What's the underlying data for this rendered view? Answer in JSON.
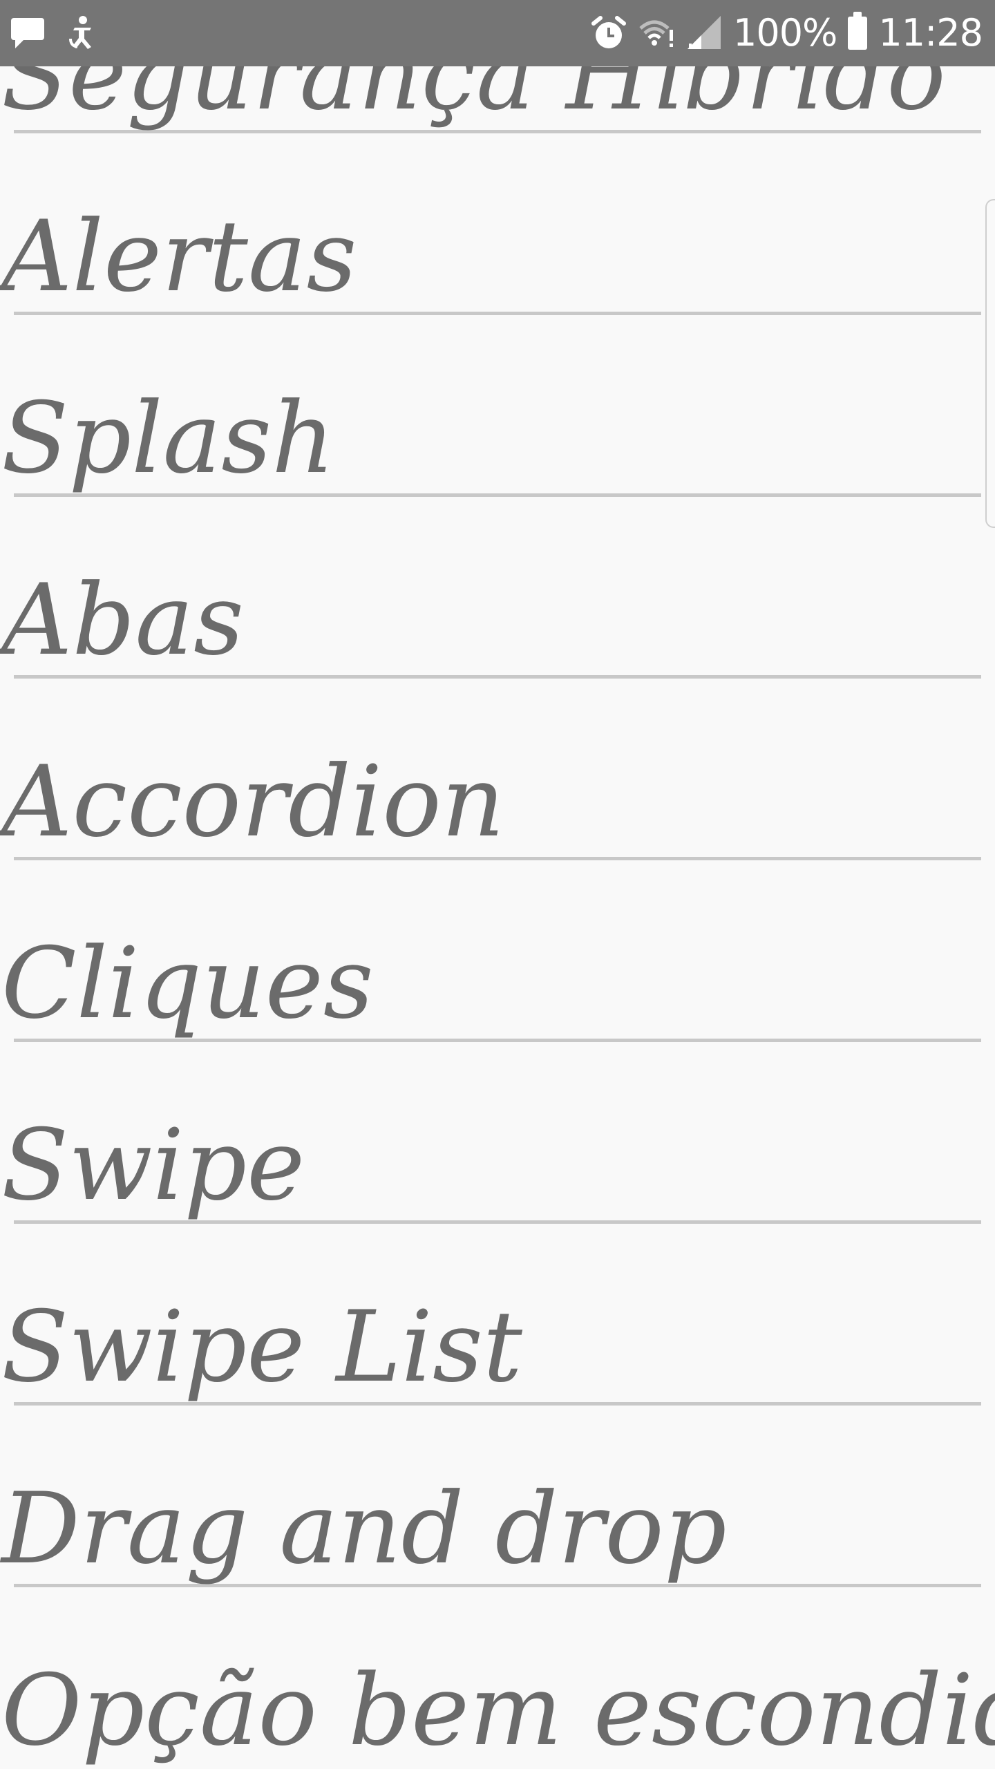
{
  "status_bar": {
    "left_icons": [
      "message-icon",
      "accessibility-icon"
    ],
    "right_icons": [
      "alarm-icon",
      "wifi-icon",
      "signal-icon",
      "battery-icon"
    ],
    "battery_percent": "100%",
    "time": "11:28"
  },
  "list": {
    "items": [
      {
        "label": "Segurança Híbrido"
      },
      {
        "label": "Alertas"
      },
      {
        "label": "Splash"
      },
      {
        "label": "Abas"
      },
      {
        "label": "Accordion"
      },
      {
        "label": "Cliques"
      },
      {
        "label": "Swipe"
      },
      {
        "label": "Swipe List"
      },
      {
        "label": "Drag and drop"
      },
      {
        "label": "Opção bem escondida"
      }
    ]
  },
  "colors": {
    "status_bar_bg": "#757575",
    "background": "#f9f9f9",
    "item_text": "#6b6b6b",
    "divider": "#c8c8c8"
  }
}
